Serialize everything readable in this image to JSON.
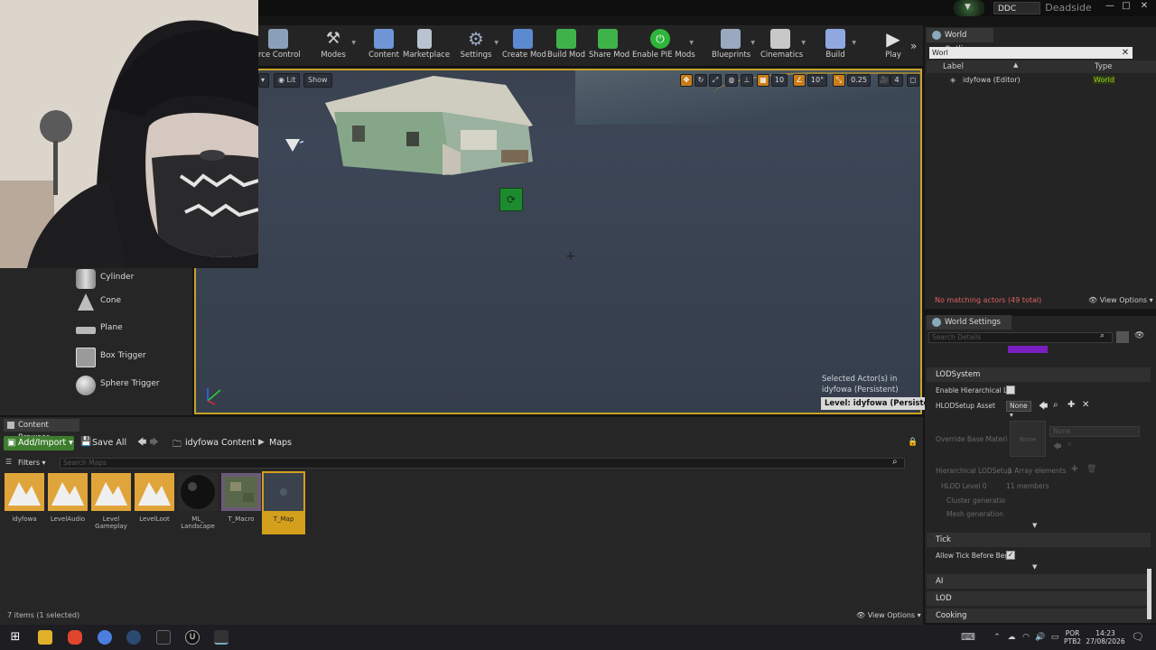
{
  "titlebar": {
    "ddc_label": "DDC",
    "project_name": "Deadside",
    "minimize": "—",
    "maximize": "□",
    "close": "✕"
  },
  "toolbar": {
    "items": [
      {
        "label": "rce Control",
        "icon": "source-control-icon",
        "color": "#8aa0b8"
      },
      {
        "label": "Modes",
        "icon": "modes-icon",
        "color": "#c9c9c9"
      },
      {
        "label": "Content",
        "icon": "content-icon",
        "color": "#7a9fd8"
      },
      {
        "label": "Marketplace",
        "icon": "marketplace-icon",
        "color": "#b9c2cf"
      },
      {
        "label": "Settings",
        "icon": "settings-icon",
        "color": "#9aa8c0"
      },
      {
        "label": "Create Mod",
        "icon": "create-mod-icon",
        "color": "#6a9ad8"
      },
      {
        "label": "Build Mod",
        "icon": "build-mod-icon",
        "color": "#3fb34a"
      },
      {
        "label": "Share Mod",
        "icon": "share-mod-icon",
        "color": "#3fb34a"
      },
      {
        "label": "Enable PIE Mods",
        "icon": "pie-mods-icon",
        "color": "#2fb53a"
      },
      {
        "label": "Blueprints",
        "icon": "blueprints-icon",
        "color": "#9aa8c0"
      },
      {
        "label": "Cinematics",
        "icon": "cinematics-icon",
        "color": "#c8c8c8"
      },
      {
        "label": "Build",
        "icon": "build-icon",
        "color": "#8fa8e0"
      },
      {
        "label": "Play",
        "icon": "play-icon",
        "color": "#e0e0e0"
      }
    ]
  },
  "viewport": {
    "buttons": {
      "lit": "Lit",
      "show": "Show"
    },
    "snap_values": {
      "grid": "10",
      "rotate": "10°",
      "scale": "0.25",
      "camera": "4"
    },
    "selected_info_line1": "Selected Actor(s) in",
    "selected_info_line2": "idyfowa (Persistent)",
    "level_badge": "Level:  idyfowa (Persistent)"
  },
  "place_panel": {
    "items": [
      {
        "label": "Cylinder"
      },
      {
        "label": "Cone"
      },
      {
        "label": "Plane"
      },
      {
        "label": "Box Trigger"
      },
      {
        "label": "Sphere Trigger"
      }
    ]
  },
  "outliner": {
    "tab_title": "World Outliner",
    "search_value": "Worl",
    "col_label": "Label",
    "col_type": "Type",
    "rows": [
      {
        "label": "idyfowa (Editor)",
        "type": "World"
      }
    ],
    "status": "No matching actors (49 total)",
    "view_options": "View Options"
  },
  "world_settings": {
    "tab_title": "World Settings",
    "search_placeholder": "Search Details",
    "sections": {
      "lod": "LODSystem",
      "tick": "Tick",
      "ai": "AI",
      "lod2": "LOD",
      "cooking": "Cooking"
    },
    "props": {
      "enable_hlod": "Enable Hierarchical LC",
      "hlod_setup": "HLODSetup Asset",
      "hlod_none": "None",
      "override_base": "Override Base Materi",
      "none_thumb": "None",
      "none_combo": "None",
      "hier_lod_setup": "Hierarchical LODSetup",
      "array_elements": "1 Array elements",
      "hlod_level": "HLOD Level 0",
      "members": "11 members",
      "cluster_gen": "Cluster generatio",
      "mesh_gen": "Mesh generation",
      "allow_tick": "Allow Tick Before Beg"
    }
  },
  "content_browser": {
    "tab_title": "Content Browser",
    "add_import": "Add/Import",
    "save_all": "Save All",
    "path": [
      "idyfowa Content",
      "Maps"
    ],
    "filters": "Filters",
    "search_placeholder": "Search Maps",
    "assets": [
      {
        "label": "idyfowa",
        "kind": "map"
      },
      {
        "label": "LevelAudio",
        "kind": "map"
      },
      {
        "label": "Level Gameplay",
        "kind": "map"
      },
      {
        "label": "LevelLoot",
        "kind": "map"
      },
      {
        "label": "ML_ Landscape",
        "kind": "sphere"
      },
      {
        "label": "T_Macro",
        "kind": "texture"
      },
      {
        "label": "T_Map",
        "kind": "selected"
      }
    ],
    "status": "7 items (1 selected)",
    "view_options": "View Options"
  },
  "taskbar": {
    "lang_line1": "POR",
    "lang_line2": "PTB2",
    "time": "14:23",
    "date": "27/08/2026"
  }
}
